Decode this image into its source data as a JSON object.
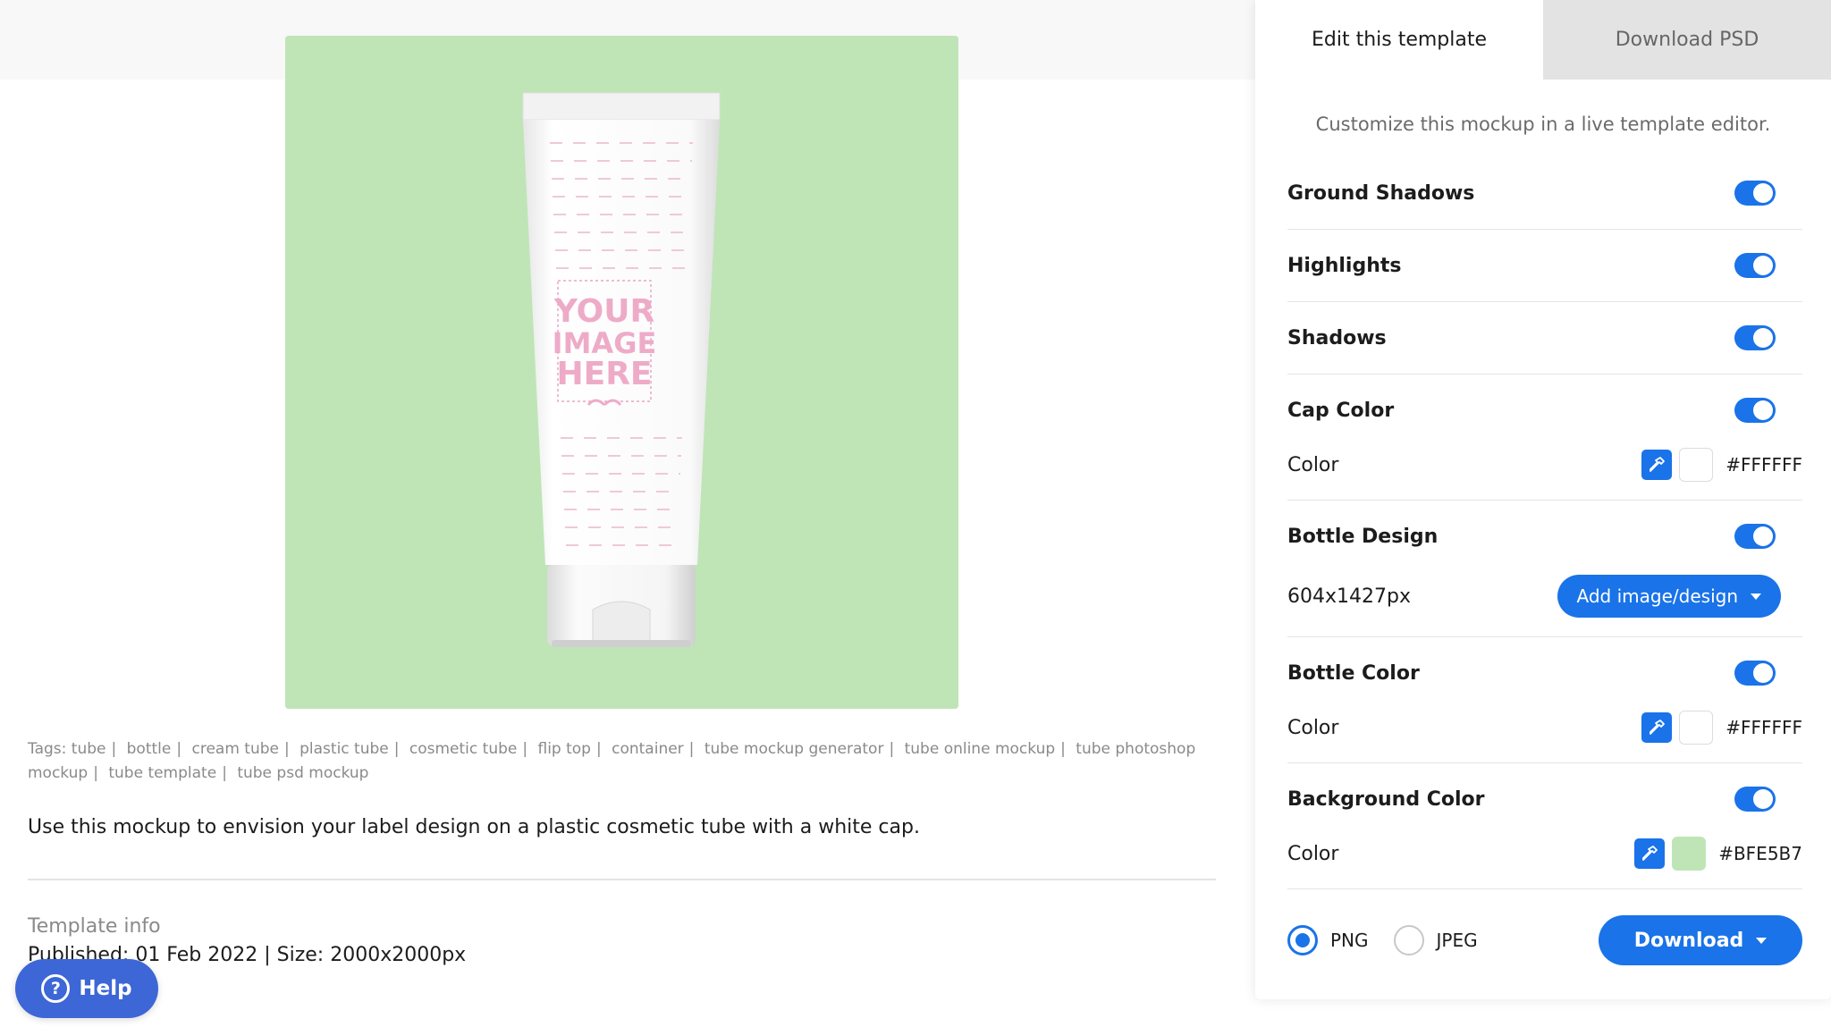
{
  "tabs": {
    "edit": "Edit this template",
    "download_psd": "Download PSD"
  },
  "panel": {
    "subtitle": "Customize this mockup in a live template editor.",
    "ground_shadows": {
      "label": "Ground Shadows",
      "enabled": true
    },
    "highlights": {
      "label": "Highlights",
      "enabled": true
    },
    "shadows": {
      "label": "Shadows",
      "enabled": true
    },
    "cap_color": {
      "label": "Cap Color",
      "enabled": true,
      "sub_label": "Color",
      "hex": "#FFFFFF"
    },
    "bottle_design": {
      "label": "Bottle Design",
      "enabled": true,
      "size": "604x1427px",
      "button": "Add image/design"
    },
    "bottle_color": {
      "label": "Bottle Color",
      "enabled": true,
      "sub_label": "Color",
      "hex": "#FFFFFF"
    },
    "background_color": {
      "label": "Background Color",
      "enabled": true,
      "sub_label": "Color",
      "hex": "#BFE5B7"
    },
    "formats": {
      "png": "PNG",
      "jpeg": "JPEG",
      "selected": "PNG"
    },
    "download_button": "Download"
  },
  "preview": {
    "placeholder_line1": "YOUR",
    "placeholder_line2": "IMAGE",
    "placeholder_line3": "HERE",
    "background": "#BFE5B7"
  },
  "tags": {
    "prefix": "Tags:",
    "items": [
      "tube",
      "bottle",
      "cream tube",
      "plastic tube",
      "cosmetic tube",
      "flip top",
      "container",
      "tube mockup generator",
      "tube online mockup",
      "tube photoshop mockup",
      "tube template",
      "tube psd mockup"
    ]
  },
  "description": "Use this mockup to envision your label design on a plastic cosmetic tube with a white cap.",
  "template_info": {
    "heading": "Template info",
    "meta": "Published: 01 Feb 2022 | Size: 2000x2000px"
  },
  "help": {
    "label": "Help",
    "icon": "question-circle-icon"
  },
  "colors": {
    "accent": "#1A73E8",
    "help_button": "#3D66D6"
  }
}
